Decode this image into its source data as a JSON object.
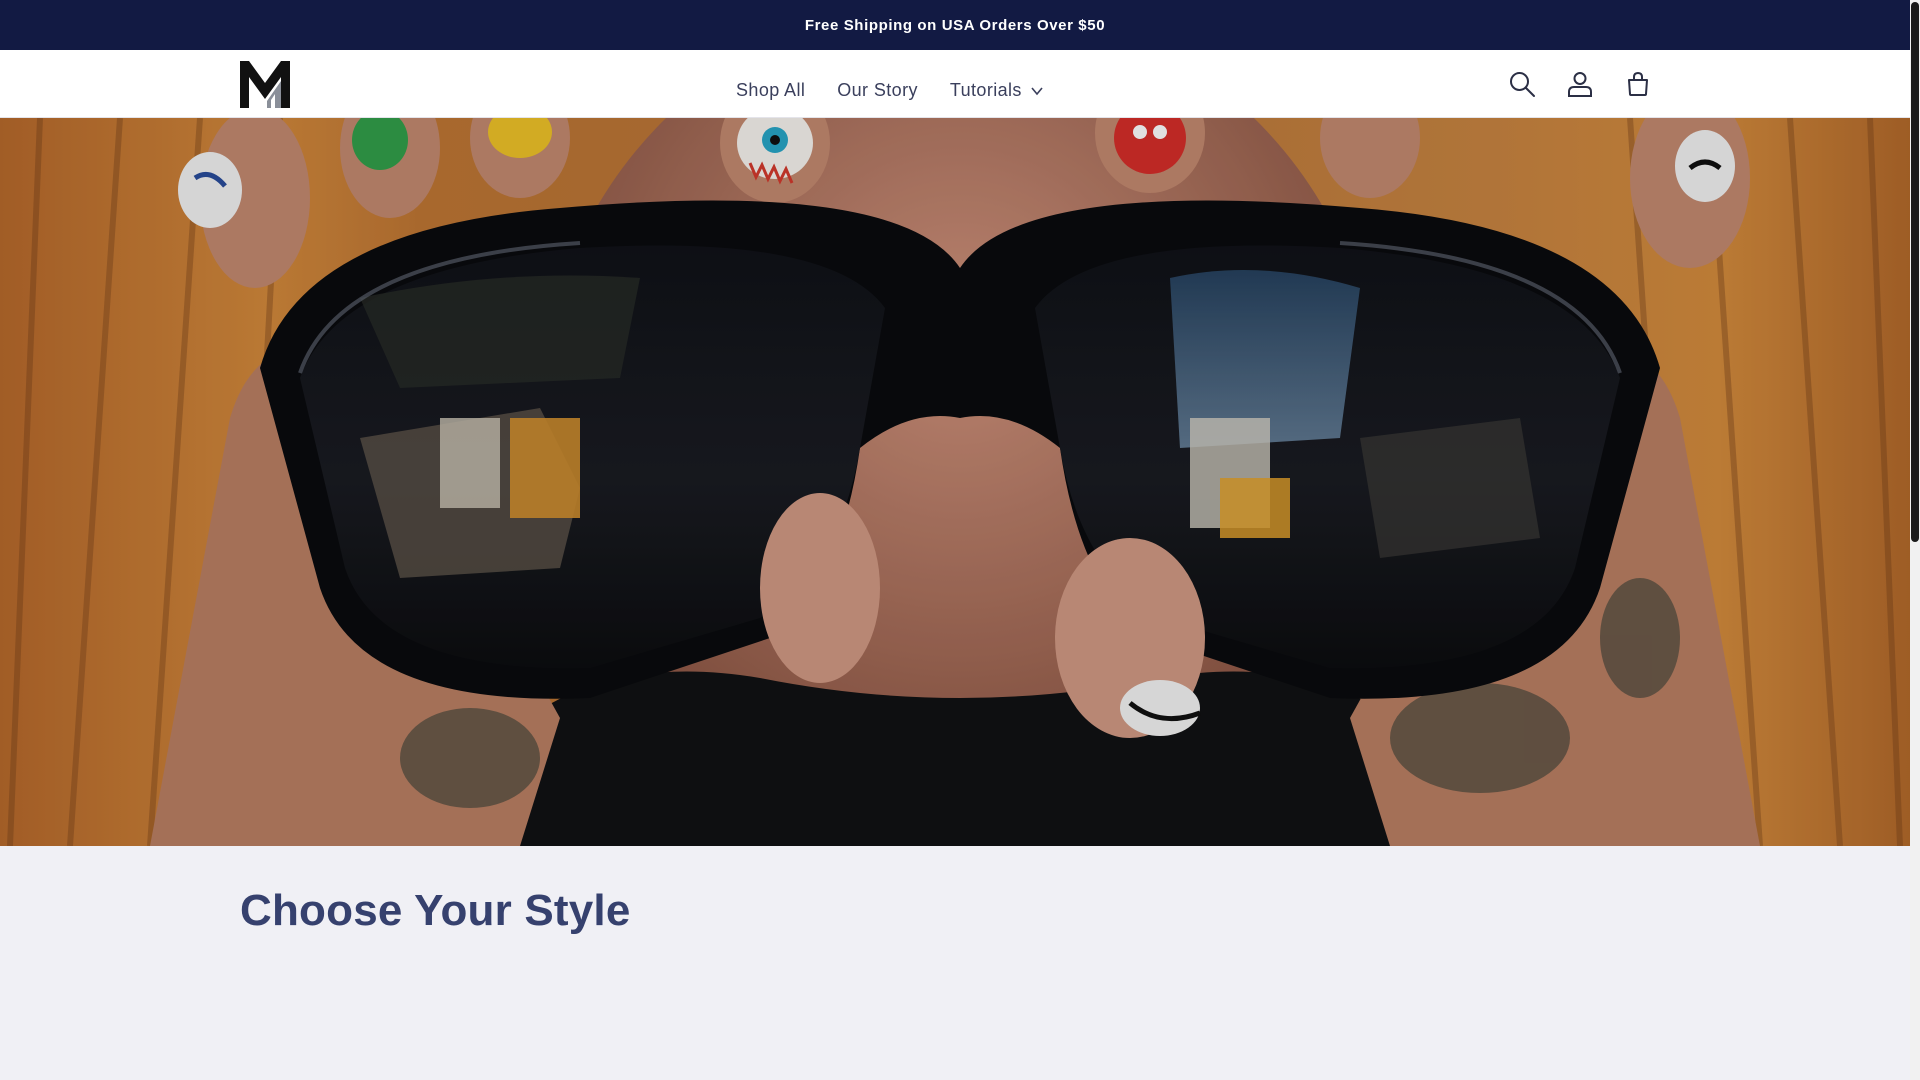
{
  "announcement": {
    "text": "Free Shipping on USA Orders Over $50"
  },
  "header": {
    "logo_icon": "mn-logo-icon",
    "nav": [
      {
        "label": "Shop All"
      },
      {
        "label": "Our Story"
      },
      {
        "label": "Tutorials",
        "has_dropdown": true
      }
    ],
    "icons": [
      "search-icon",
      "account-icon",
      "cart-icon"
    ]
  },
  "hero": {
    "image": "man-holding-sunglasses-with-painted-nails"
  },
  "section": {
    "title": "Choose Your Style"
  },
  "colors": {
    "announcement_bg": "#121a43",
    "title": "#36416e",
    "nav_text": "#3a3f5c",
    "page_bg": "#f0f0f5"
  }
}
